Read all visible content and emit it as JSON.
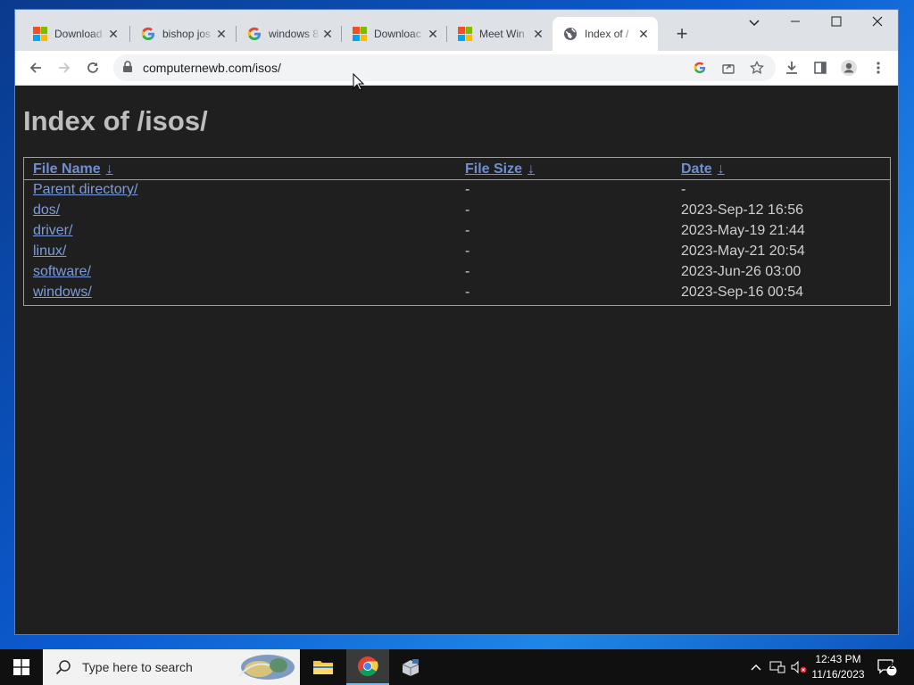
{
  "browser": {
    "tabs": [
      {
        "label": "Download",
        "favicon": "microsoft-logo",
        "active": false
      },
      {
        "label": "bishop jos",
        "favicon": "google-logo",
        "active": false
      },
      {
        "label": "windows 8",
        "favicon": "google-logo",
        "active": false
      },
      {
        "label": "Downloac",
        "favicon": "microsoft-logo",
        "active": false
      },
      {
        "label": "Meet Win",
        "favicon": "microsoft-logo",
        "active": false
      },
      {
        "label": "Index of /",
        "favicon": "globe-icon",
        "active": true
      }
    ],
    "new_tab_symbol": "+",
    "url": "computernewb.com/isos/"
  },
  "page": {
    "heading": "Index of /isos/",
    "columns": [
      {
        "label": "File Name",
        "sort_arrow": "↓"
      },
      {
        "label": "File Size",
        "sort_arrow": "↓"
      },
      {
        "label": "Date",
        "sort_arrow": "↓"
      }
    ],
    "rows": [
      {
        "name": "Parent directory/",
        "size": "-",
        "date": "-"
      },
      {
        "name": "dos/",
        "size": "-",
        "date": "2023-Sep-12 16:56"
      },
      {
        "name": "driver/",
        "size": "-",
        "date": "2023-May-19 21:44"
      },
      {
        "name": "linux/",
        "size": "-",
        "date": "2023-May-21 20:54"
      },
      {
        "name": "software/",
        "size": "-",
        "date": "2023-Jun-26 03:00"
      },
      {
        "name": "windows/",
        "size": "-",
        "date": "2023-Sep-16 00:54"
      }
    ]
  },
  "taskbar": {
    "search_placeholder": "Type here to search",
    "time": "12:43 PM",
    "date": "11/16/2023",
    "notification_count": "2"
  },
  "colors": {
    "page_background": "#1f1f1f",
    "link": "#7c9cd9",
    "heading": "#bdbdbd"
  }
}
